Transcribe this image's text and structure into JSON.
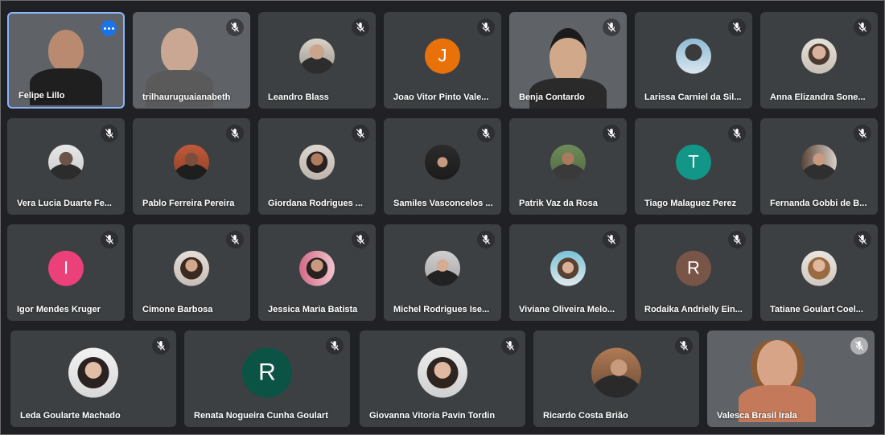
{
  "colors": {
    "tile": "#3c4043",
    "background": "#202124",
    "highlight": "#8ab4f8",
    "menu_button": "#1a73e8"
  },
  "participants": [
    {
      "name": "Felipe Lillo",
      "kind": "video",
      "options_icon": "more-options-icon",
      "highlighted": true
    },
    {
      "name": "trilhauruguaianabeth",
      "kind": "video",
      "mic_icon": "mic-off-icon"
    },
    {
      "name": "Leandro Blass",
      "kind": "photo",
      "mic_icon": "mic-off-icon"
    },
    {
      "name": "Joao Vitor Pinto Vale...",
      "kind": "letter",
      "letter": "J",
      "color": "#e8710a",
      "mic_icon": "mic-off-icon"
    },
    {
      "name": "Benja Contardo",
      "kind": "video",
      "mic_icon": "mic-off-icon"
    },
    {
      "name": "Larissa Carniel da Sil...",
      "kind": "photo",
      "mic_icon": "mic-off-icon"
    },
    {
      "name": "Anna Elizandra Sone...",
      "kind": "photo",
      "mic_icon": "mic-off-icon"
    },
    {
      "name": "Vera Lucia Duarte Fe...",
      "kind": "photo",
      "mic_icon": "mic-off-icon"
    },
    {
      "name": "Pablo Ferreira Pereira",
      "kind": "photo",
      "mic_icon": "mic-off-icon"
    },
    {
      "name": "Giordana Rodrigues ...",
      "kind": "photo",
      "mic_icon": "mic-off-icon"
    },
    {
      "name": "Samiles Vasconcelos ...",
      "kind": "photo",
      "mic_icon": "mic-off-icon"
    },
    {
      "name": "Patrik Vaz da Rosa",
      "kind": "photo",
      "mic_icon": "mic-off-icon"
    },
    {
      "name": "Tiago Malaguez Perez",
      "kind": "letter",
      "letter": "T",
      "color": "#129688",
      "mic_icon": "mic-off-icon"
    },
    {
      "name": "Fernanda Gobbi de B...",
      "kind": "photo",
      "mic_icon": "mic-off-icon"
    },
    {
      "name": "Igor Mendes Kruger",
      "kind": "letter",
      "letter": "I",
      "color": "#ec407a",
      "mic_icon": "mic-off-icon"
    },
    {
      "name": "Cimone Barbosa",
      "kind": "photo",
      "mic_icon": "mic-off-icon"
    },
    {
      "name": "Jessica Maria Batista",
      "kind": "photo",
      "mic_icon": "mic-off-icon"
    },
    {
      "name": "Michel Rodrigues Ise...",
      "kind": "photo",
      "mic_icon": "mic-off-icon"
    },
    {
      "name": "Viviane Oliveira Melo...",
      "kind": "photo",
      "mic_icon": "mic-off-icon"
    },
    {
      "name": "Rodaika Andrielly Ein...",
      "kind": "letter",
      "letter": "R",
      "color": "#795548",
      "mic_icon": "mic-off-icon"
    },
    {
      "name": "Tatiane Goulart Coel...",
      "kind": "photo",
      "mic_icon": "mic-off-icon"
    },
    {
      "name": "Leda Goularte Machado",
      "kind": "photo",
      "mic_icon": "mic-off-icon"
    },
    {
      "name": "Renata Nogueira Cunha Goulart",
      "kind": "letter",
      "letter": "R",
      "color": "#0b5345",
      "mic_icon": "mic-off-icon"
    },
    {
      "name": "Giovanna Vitoria Pavin Tordin",
      "kind": "photo",
      "mic_icon": "mic-off-icon"
    },
    {
      "name": "Ricardo Costa Brião",
      "kind": "photo",
      "mic_icon": "mic-off-icon"
    },
    {
      "name": "Valesca Brasil Irala",
      "kind": "video",
      "mic_icon": "mic-off-icon"
    }
  ]
}
